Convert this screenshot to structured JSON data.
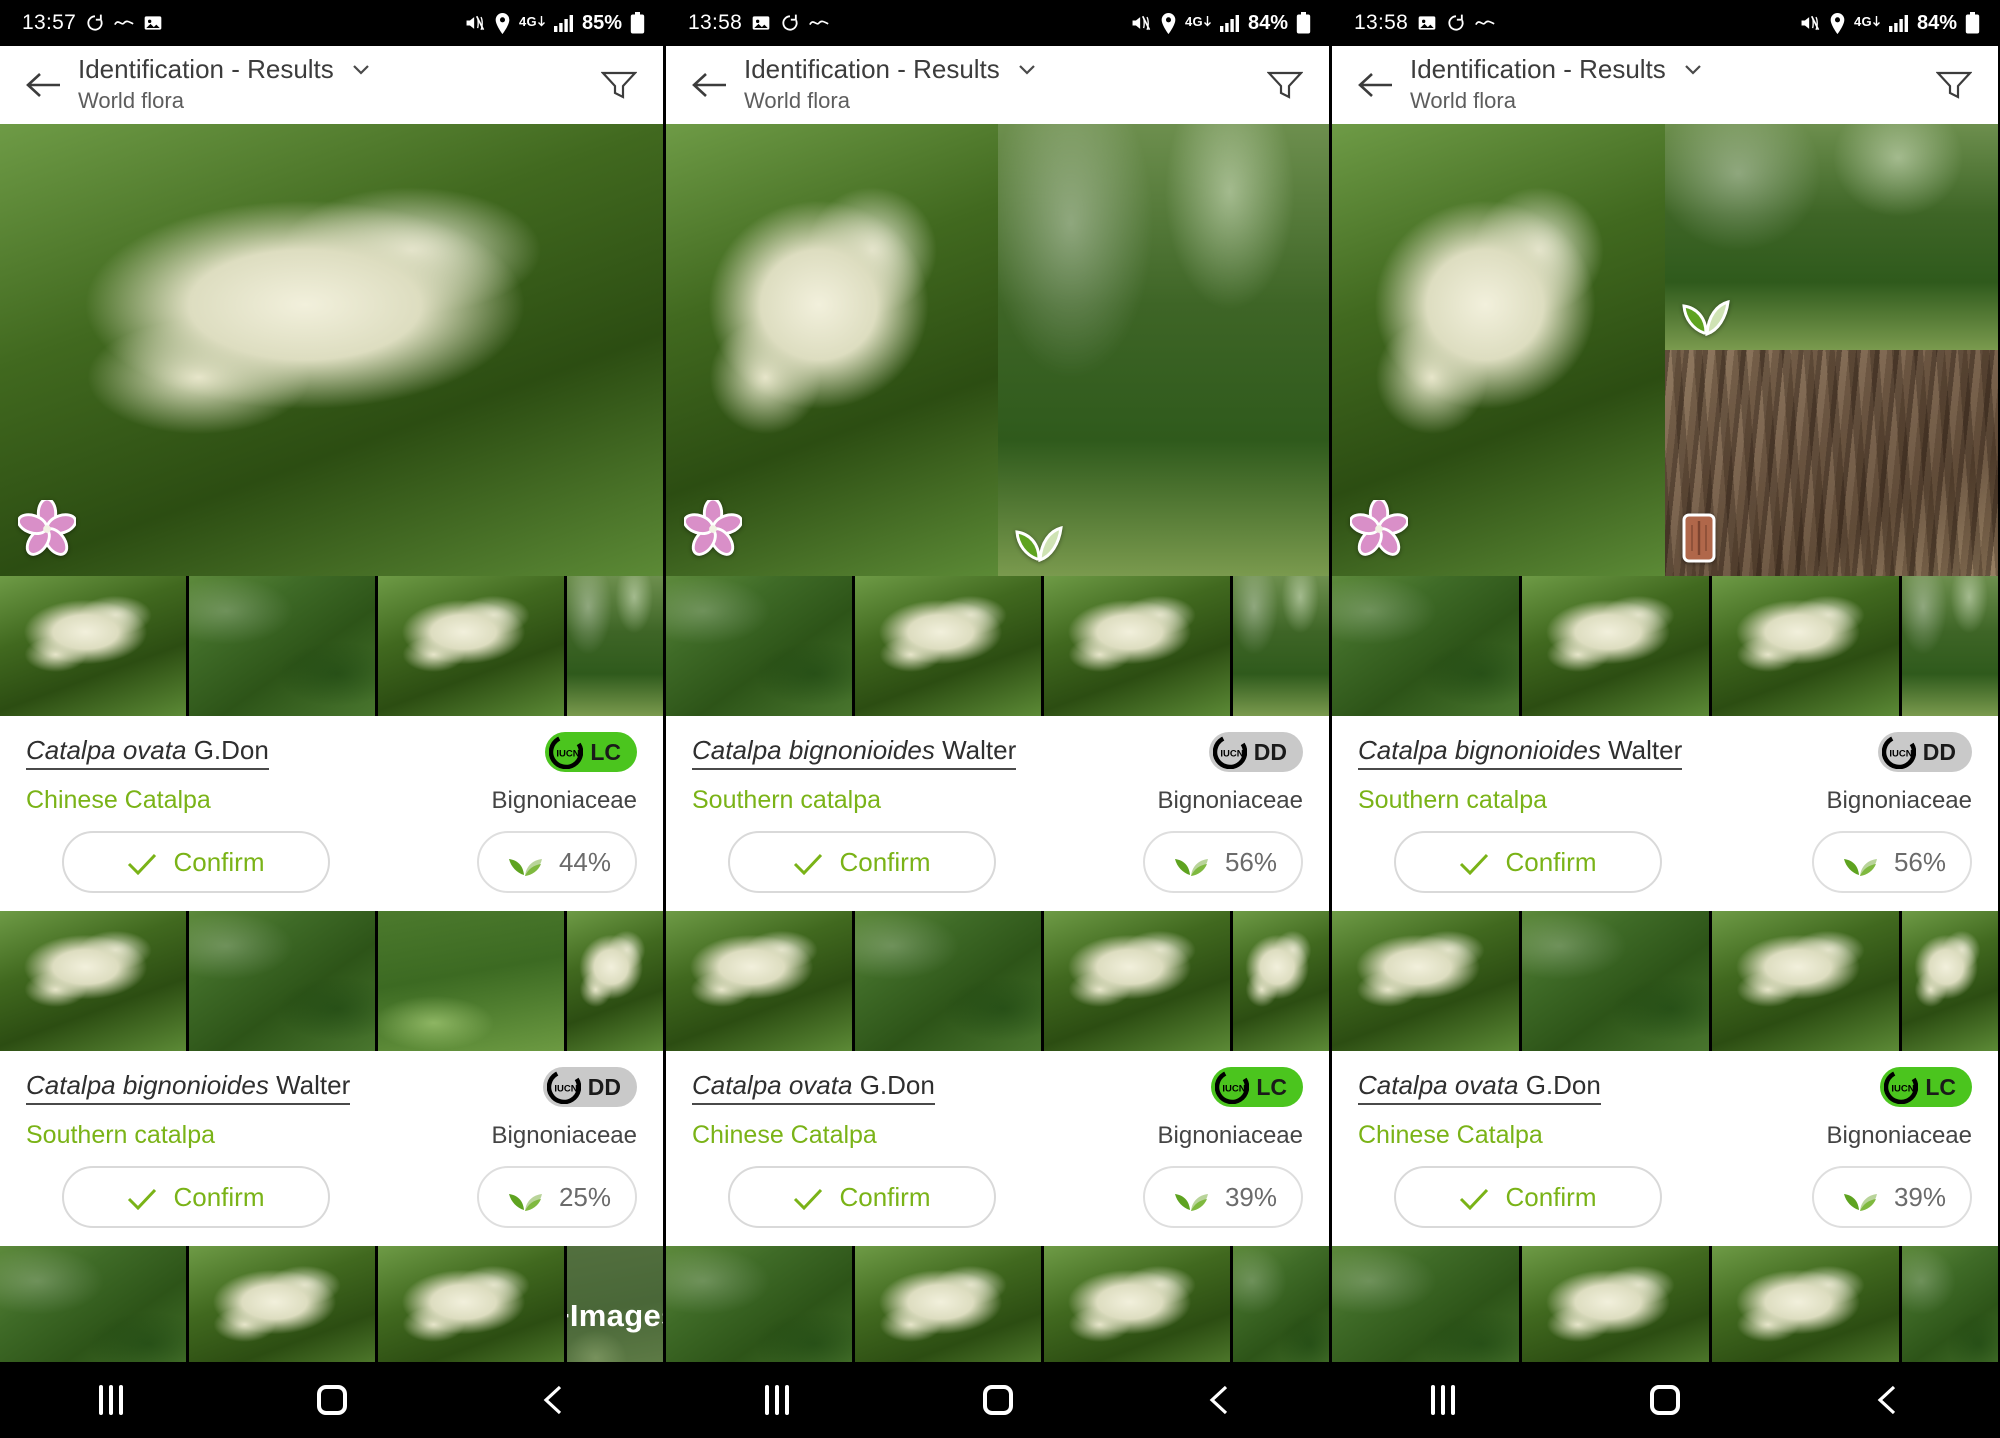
{
  "app": {
    "title": "Identification - Results",
    "subtitle": "World flora",
    "back_icon": "arrow-left-icon",
    "chevron_icon": "chevron-down-icon",
    "filter_icon": "filter-icon"
  },
  "navbar": {
    "recents_label": "recents-icon",
    "home_label": "home-icon",
    "back_label": "back-icon"
  },
  "colors": {
    "accent_green": "#7ab317",
    "iucn_lc": "#4bc51e",
    "iucn_dd": "#c9c9c9",
    "status_bar": "#000000"
  },
  "panels": [
    {
      "id": "panel-1",
      "status": {
        "time": "13:57",
        "battery": "85%",
        "network": "4G",
        "icons": [
          "refresh-icon",
          "wave-icon",
          "image-icon",
          "mute-icon",
          "location-icon",
          "signal-icon",
          "battery-icon"
        ]
      },
      "hero": {
        "images": [
          {
            "organ": "flower-badge",
            "kind": "flowerbg"
          }
        ]
      },
      "results": [
        {
          "scientific_genus_species": "Catalpa ovata",
          "author": "G.Don",
          "common_name": "Chinese Catalpa",
          "family": "Bignoniaceae",
          "iucn_status": "LC",
          "iucn_label": "IUCN",
          "score": "44%",
          "confirm_label": "Confirm",
          "thumbs_overlay": null
        },
        {
          "scientific_genus_species": "Catalpa bignonioides",
          "author": "Walter",
          "common_name": "Southern catalpa",
          "family": "Bignoniaceae",
          "iucn_status": "DD",
          "iucn_label": "IUCN",
          "score": "25%",
          "confirm_label": "Confirm",
          "thumbs_overlay": "+Images"
        }
      ]
    },
    {
      "id": "panel-2",
      "status": {
        "time": "13:58",
        "battery": "84%",
        "network": "4G",
        "icons": [
          "image-icon",
          "refresh-icon",
          "wave-icon",
          "mute-icon",
          "location-icon",
          "signal-icon",
          "battery-icon"
        ]
      },
      "hero": {
        "images": [
          {
            "organ": "flower-badge",
            "kind": "flowerbg"
          },
          {
            "organ": "leaf-badge",
            "kind": "treebg"
          }
        ]
      },
      "results": [
        {
          "scientific_genus_species": "Catalpa bignonioides",
          "author": "Walter",
          "common_name": "Southern catalpa",
          "family": "Bignoniaceae",
          "iucn_status": "DD",
          "iucn_label": "IUCN",
          "score": "56%",
          "confirm_label": "Confirm",
          "thumbs_overlay": null
        },
        {
          "scientific_genus_species": "Catalpa ovata",
          "author": "G.Don",
          "common_name": "Chinese Catalpa",
          "family": "Bignoniaceae",
          "iucn_status": "LC",
          "iucn_label": "IUCN",
          "score": "39%",
          "confirm_label": "Confirm",
          "thumbs_overlay": null
        }
      ]
    },
    {
      "id": "panel-3",
      "status": {
        "time": "13:58",
        "battery": "84%",
        "network": "4G",
        "icons": [
          "image-icon",
          "refresh-icon",
          "wave-icon",
          "mute-icon",
          "location-icon",
          "signal-icon",
          "battery-icon"
        ]
      },
      "hero": {
        "images": [
          {
            "organ": "flower-badge",
            "kind": "flowerbg"
          },
          {
            "organ": "leaf-badge",
            "kind": "treebg"
          },
          {
            "organ": "bark-badge",
            "kind": "barkbg"
          }
        ]
      },
      "results": [
        {
          "scientific_genus_species": "Catalpa bignonioides",
          "author": "Walter",
          "common_name": "Southern catalpa",
          "family": "Bignoniaceae",
          "iucn_status": "DD",
          "iucn_label": "IUCN",
          "score": "56%",
          "confirm_label": "Confirm",
          "thumbs_overlay": null
        },
        {
          "scientific_genus_species": "Catalpa ovata",
          "author": "G.Don",
          "common_name": "Chinese Catalpa",
          "family": "Bignoniaceae",
          "iucn_status": "LC",
          "iucn_label": "IUCN",
          "score": "39%",
          "confirm_label": "Confirm",
          "thumbs_overlay": null
        }
      ]
    }
  ]
}
